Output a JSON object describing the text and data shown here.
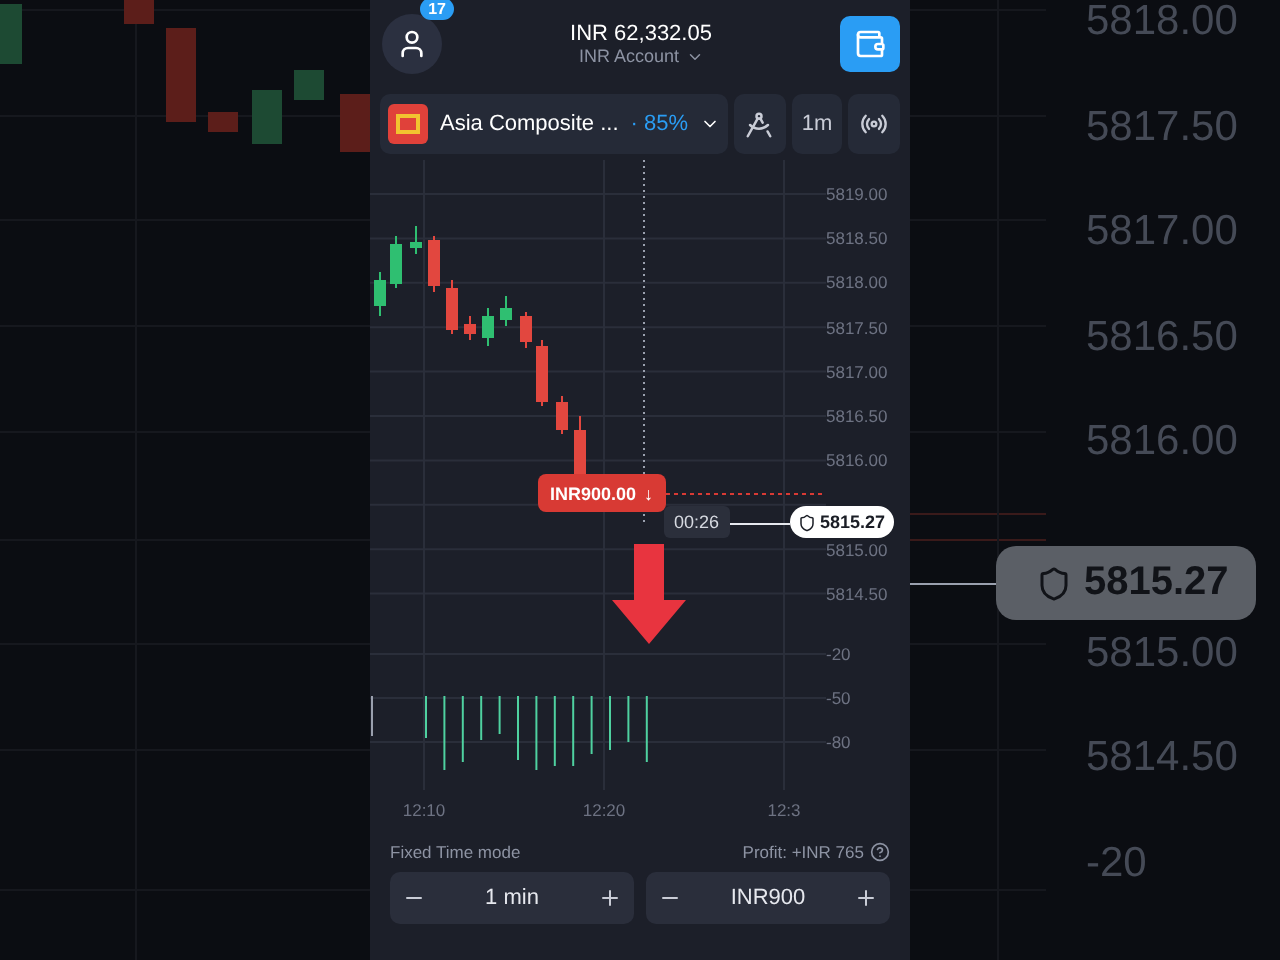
{
  "header": {
    "notification_count": "17",
    "balance": "INR 62,332.05",
    "account": "INR Account"
  },
  "toolbar": {
    "asset": "Asia Composite ...",
    "payout": "· 85%",
    "timeframe": "1m"
  },
  "chart": {
    "price_ticks_upper": [
      "5819.00",
      "5818.50",
      "5818.00",
      "5817.50",
      "5817.00",
      "5816.50",
      "5816.00"
    ],
    "price_ticks_lower": [
      "5815.00",
      "5814.50"
    ],
    "indicator_ticks": [
      "-20",
      "-50",
      "-80"
    ],
    "time_ticks": [
      "12:10",
      "12:20",
      "12:3"
    ],
    "trade": {
      "amount": "INR900.00",
      "arrow": "↓"
    },
    "timer": "00:26",
    "current_price": "5815.27"
  },
  "order": {
    "mode": "Fixed Time mode",
    "profit": "Profit: +INR 765",
    "duration": "1 min",
    "amount": "INR900"
  },
  "backdrop": {
    "price_ticks_upper": [
      "5818.00",
      "5817.50",
      "5817.00",
      "5816.50",
      "5816.00"
    ],
    "price_ticks_lower": [
      "5815.00",
      "5814.50"
    ],
    "indicator_tick": "-20",
    "current_price": "5815.27"
  }
}
